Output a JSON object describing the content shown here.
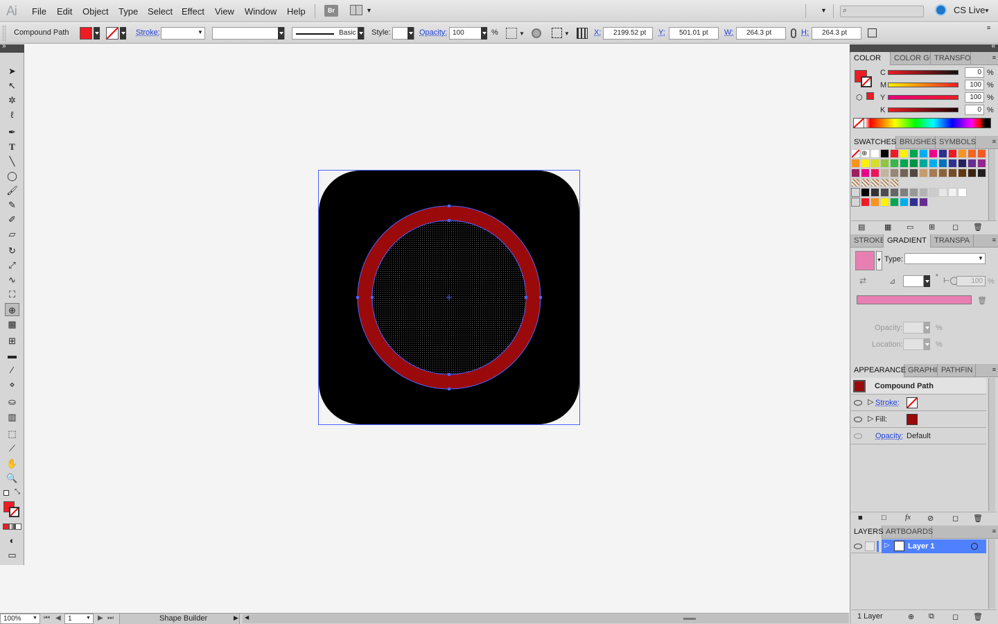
{
  "menubar": {
    "logo": "Ai",
    "items": [
      "File",
      "Edit",
      "Object",
      "Type",
      "Select",
      "Effect",
      "View",
      "Window",
      "Help"
    ],
    "bridge_label": "Br",
    "cslive_label": "CS Live"
  },
  "controlbar": {
    "selection_label": "Compound Path",
    "stroke_label": "Stroke:",
    "stroke_profile": "Basic",
    "style_label": "Style:",
    "opacity_label": "Opacity:",
    "opacity_value": "100",
    "opacity_unit": "%",
    "x_label": "X:",
    "x_value": "2199.52 pt",
    "y_label": "Y:",
    "y_value": "501.01 pt",
    "w_label": "W:",
    "w_value": "264.3 pt",
    "h_label": "H:",
    "h_value": "264.3 pt"
  },
  "tools": [
    "selection-tool",
    "direct-selection-tool",
    "magic-wand-tool",
    "lasso-tool",
    "pen-tool",
    "type-tool",
    "line-tool",
    "ellipse-tool",
    "paintbrush-tool",
    "pencil-tool",
    "blob-brush-tool",
    "eraser-tool",
    "rotate-tool",
    "scale-tool",
    "warp-tool",
    "free-transform-tool",
    "shape-builder-tool",
    "perspective-grid-tool",
    "mesh-tool",
    "gradient-tool",
    "eyedropper-tool",
    "blend-tool",
    "symbol-sprayer-tool",
    "column-graph-tool",
    "artboard-tool",
    "slice-tool",
    "hand-tool",
    "zoom-tool"
  ],
  "color_panel": {
    "tabs": [
      "COLOR",
      "COLOR GU",
      "TRANSFOR"
    ],
    "channels": [
      {
        "label": "C",
        "value": "0"
      },
      {
        "label": "M",
        "value": "100"
      },
      {
        "label": "Y",
        "value": "100"
      },
      {
        "label": "K",
        "value": "0"
      }
    ],
    "unit": "%"
  },
  "swatches_panel": {
    "tabs": [
      "SWATCHES",
      "BRUSHES",
      "SYMBOLS"
    ]
  },
  "gradient_panel": {
    "tabs": [
      "STROKE",
      "GRADIENT",
      "TRANSPA"
    ],
    "type_label": "Type:",
    "angle_label": "⊿",
    "aspect_value": "100",
    "unit": "%",
    "opacity_label": "Opacity:",
    "location_label": "Location:"
  },
  "appearance_panel": {
    "tabs": [
      "APPEARANCE",
      "GRAPHIC",
      "PATHFIN"
    ],
    "title": "Compound Path",
    "stroke_label": "Stroke:",
    "fill_label": "Fill:",
    "opacity_label": "Opacity:",
    "opacity_value": "Default"
  },
  "layers_panel": {
    "tabs": [
      "LAYERS",
      "ARTBOARDS"
    ],
    "layer_name": "Layer 1",
    "count": "1 Layer"
  },
  "statusbar": {
    "zoom": "100%",
    "artboard_number": "1",
    "current_tool": "Shape Builder"
  },
  "colors": {
    "fill": "#ee1c24",
    "ring": "#9b0a0a",
    "artwork_bg": "#000000",
    "selection": "#4a63ff",
    "canvas": "#f4f4f4"
  }
}
